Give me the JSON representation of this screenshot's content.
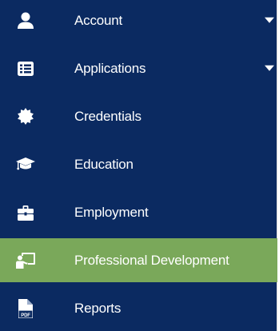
{
  "menu": {
    "items": [
      {
        "label": "Account",
        "icon": "user-icon",
        "has_submenu": true
      },
      {
        "label": "Applications",
        "icon": "list-icon",
        "has_submenu": true
      },
      {
        "label": "Credentials",
        "icon": "certificate-icon",
        "has_submenu": false
      },
      {
        "label": "Education",
        "icon": "graduation-cap-icon",
        "has_submenu": false
      },
      {
        "label": "Employment",
        "icon": "briefcase-icon",
        "has_submenu": false
      },
      {
        "label": "Professional Development",
        "icon": "chalkboard-teacher-icon",
        "has_submenu": false,
        "active": true
      },
      {
        "label": "Reports",
        "icon": "pdf-file-icon",
        "has_submenu": false
      }
    ]
  },
  "colors": {
    "sidebar_bg": "#0b2a61",
    "active_bg": "#7aa85a",
    "text": "#ffffff"
  }
}
